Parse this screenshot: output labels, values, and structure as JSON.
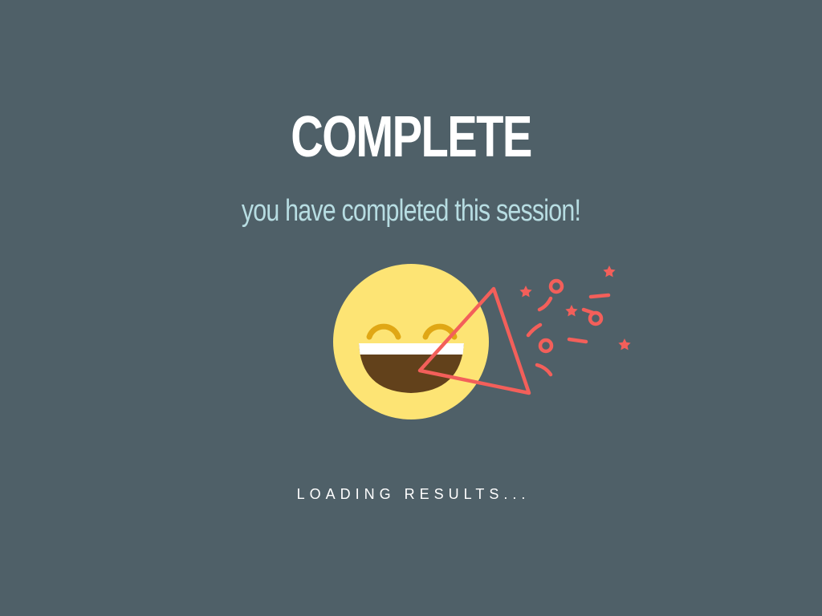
{
  "screen": {
    "title": "COMPLETE",
    "subtitle": "you have completed this session!",
    "status": "LOADING RESULTS..."
  },
  "illustration": {
    "icons": [
      "laughing-face-icon",
      "party-popper-icon",
      "confetti-icon"
    ]
  },
  "colors": {
    "background": "#4f6068",
    "title": "#ffffff",
    "subtitle": "#b7dde2",
    "face": "#fde474",
    "eyes": "#e0a715",
    "mouth": "#62411b",
    "teeth": "#ffffff",
    "popper": "#f35f5a"
  }
}
